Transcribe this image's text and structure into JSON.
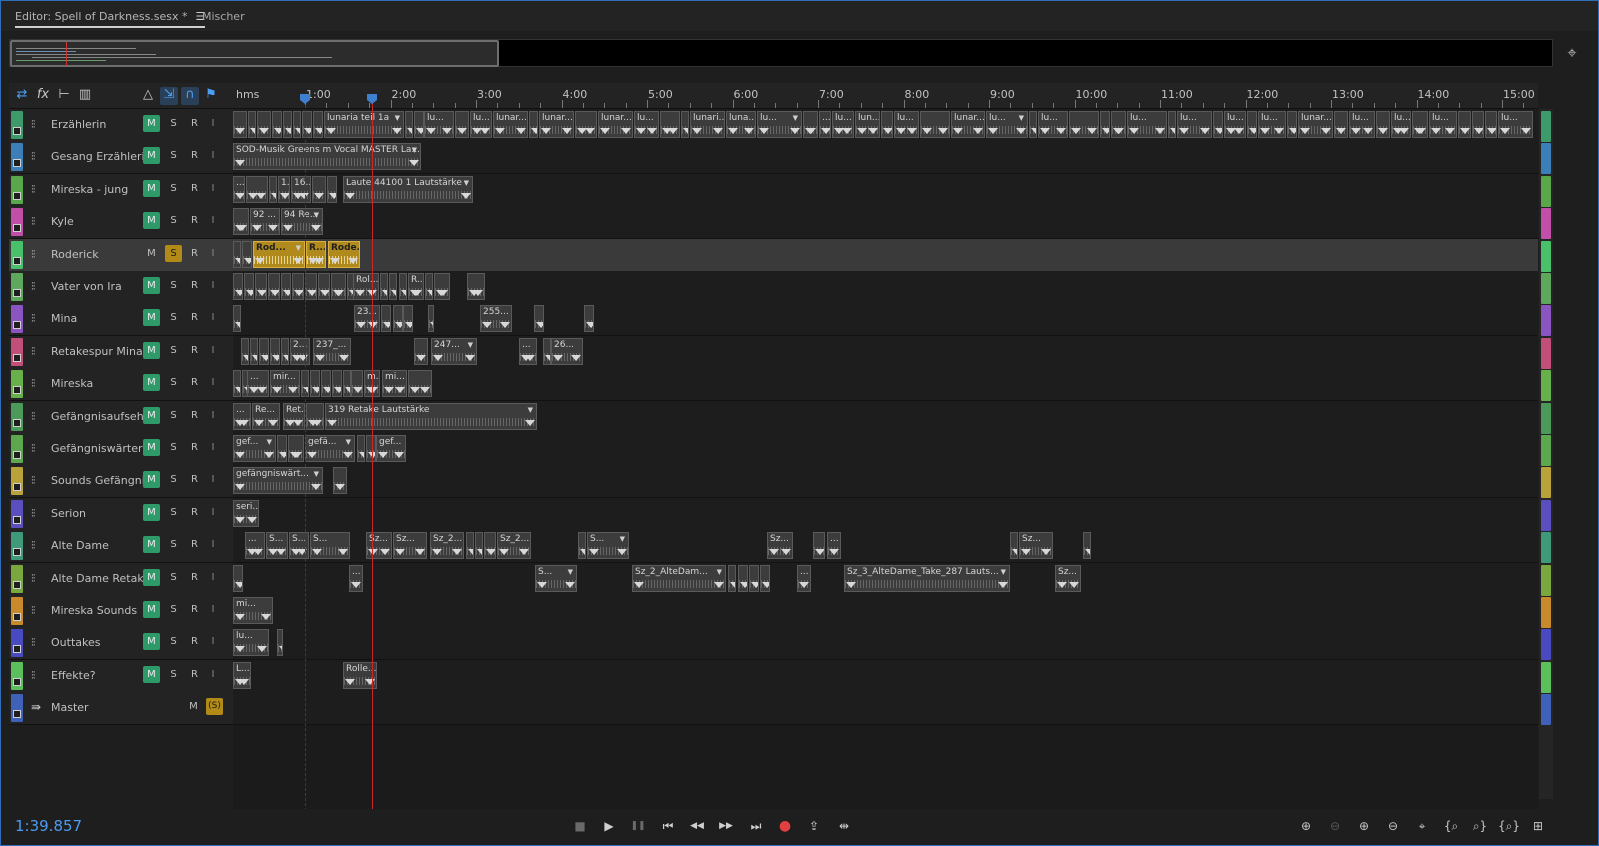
{
  "tabs": {
    "editor": "Editor: Spell of Darkness.sesx *",
    "mixer": "Mischer"
  },
  "ruler": {
    "format": "hms",
    "labels": [
      "1:00",
      "2:00",
      "3:00",
      "4:00",
      "5:00",
      "6:00",
      "7:00",
      "8:00",
      "9:00",
      "10:00",
      "11:00",
      "12:00",
      "13:00",
      "14:00",
      "15:00"
    ]
  },
  "tracks": [
    {
      "name": "Erzählerin",
      "color": "#3d9a6a",
      "mute": true,
      "solo": false,
      "clips": [
        {
          "s": 0,
          "w": 14
        },
        {
          "s": 15,
          "w": 8
        },
        {
          "s": 24,
          "w": 14
        },
        {
          "s": 39,
          "w": 10
        },
        {
          "s": 50,
          "w": 9
        },
        {
          "s": 60,
          "w": 8
        },
        {
          "s": 69,
          "w": 10
        },
        {
          "s": 80,
          "w": 10
        },
        {
          "s": 91,
          "w": 80,
          "label": "lunaria teil 1a"
        },
        {
          "s": 172,
          "w": 8
        },
        {
          "s": 181,
          "w": 10
        },
        {
          "s": 191,
          "w": 30,
          "label": "lu..."
        },
        {
          "s": 222,
          "w": 14
        },
        {
          "s": 237,
          "w": 22,
          "label": "lu..."
        },
        {
          "s": 260,
          "w": 35,
          "label": "lunar..."
        },
        {
          "s": 296,
          "w": 9
        },
        {
          "s": 306,
          "w": 35,
          "label": "lunar..."
        },
        {
          "s": 342,
          "w": 22
        },
        {
          "s": 365,
          "w": 35,
          "label": "lunar..."
        },
        {
          "s": 401,
          "w": 25,
          "label": "lu..."
        },
        {
          "s": 427,
          "w": 20
        },
        {
          "s": 448,
          "w": 8
        },
        {
          "s": 457,
          "w": 35,
          "label": "lunari..."
        },
        {
          "s": 493,
          "w": 30,
          "label": "luna..."
        },
        {
          "s": 524,
          "w": 45,
          "label": "lu..."
        },
        {
          "s": 570,
          "w": 15
        },
        {
          "s": 586,
          "w": 12,
          "label": "..."
        },
        {
          "s": 599,
          "w": 22,
          "label": "lu..."
        },
        {
          "s": 622,
          "w": 25,
          "label": "lun..."
        },
        {
          "s": 648,
          "w": 12
        },
        {
          "s": 661,
          "w": 25,
          "label": "lu..."
        },
        {
          "s": 687,
          "w": 30
        },
        {
          "s": 718,
          "w": 34,
          "label": "lunar..."
        },
        {
          "s": 753,
          "w": 42,
          "label": "lu..."
        },
        {
          "s": 796,
          "w": 8
        },
        {
          "s": 805,
          "w": 30,
          "label": "lu..."
        },
        {
          "s": 836,
          "w": 30
        },
        {
          "s": 867,
          "w": 10
        },
        {
          "s": 878,
          "w": 15
        },
        {
          "s": 894,
          "w": 40,
          "label": "lu..."
        },
        {
          "s": 935,
          "w": 8
        },
        {
          "s": 944,
          "w": 35,
          "label": "lu..."
        },
        {
          "s": 980,
          "w": 10
        },
        {
          "s": 991,
          "w": 22,
          "label": "lu..."
        },
        {
          "s": 1014,
          "w": 10
        },
        {
          "s": 1025,
          "w": 28,
          "label": "lu..."
        },
        {
          "s": 1054,
          "w": 10
        },
        {
          "s": 1065,
          "w": 35,
          "label": "lunar..."
        },
        {
          "s": 1101,
          "w": 14
        },
        {
          "s": 1116,
          "w": 26,
          "label": "lu..."
        },
        {
          "s": 1143,
          "w": 14
        },
        {
          "s": 1158,
          "w": 20,
          "label": "lu..."
        },
        {
          "s": 1179,
          "w": 16
        },
        {
          "s": 1196,
          "w": 28,
          "label": "lu..."
        },
        {
          "s": 1225,
          "w": 13
        },
        {
          "s": 1239,
          "w": 12
        },
        {
          "s": 1252,
          "w": 12
        },
        {
          "s": 1265,
          "w": 35,
          "label": "lu..."
        }
      ]
    },
    {
      "name": "Gesang Erzählerin",
      "color": "#3c7fb8",
      "mute": true,
      "solo": false,
      "clips": [
        {
          "s": 0,
          "w": 188,
          "label": "SOD-Musik Greens m Vocal MASTER La..."
        }
      ]
    },
    {
      "name": "Mireska - jung",
      "color": "#5aa64a",
      "mute": true,
      "solo": false,
      "clips": [
        {
          "s": 0,
          "w": 12,
          "label": "..."
        },
        {
          "s": 13,
          "w": 22
        },
        {
          "s": 36,
          "w": 8
        },
        {
          "s": 45,
          "w": 12,
          "label": "1..."
        },
        {
          "s": 58,
          "w": 20,
          "label": "16..."
        },
        {
          "s": 79,
          "w": 14
        },
        {
          "s": 94,
          "w": 10
        },
        {
          "s": 110,
          "w": 130,
          "label": "Laute 44100 1  Lautstärke"
        }
      ]
    },
    {
      "name": "Kyle",
      "color": "#c24fa7",
      "mute": true,
      "solo": false,
      "clips": [
        {
          "s": 0,
          "w": 16
        },
        {
          "s": 17,
          "w": 30,
          "label": "92 ..."
        },
        {
          "s": 48,
          "w": 42,
          "label": "94 Re..."
        }
      ]
    },
    {
      "name": "Roderick",
      "color": "#49c06a",
      "mute": false,
      "solo": true,
      "selected": true,
      "clips": [
        {
          "s": 0,
          "w": 8
        },
        {
          "s": 9,
          "w": 10
        },
        {
          "s": 20,
          "w": 52,
          "label": "Rod...",
          "gold": true
        },
        {
          "s": 73,
          "w": 20,
          "label": "R...",
          "gold": true
        },
        {
          "s": 95,
          "w": 32,
          "label": "Rode...",
          "gold": true
        }
      ]
    },
    {
      "name": "Vater von Ira",
      "color": "#5ea85e",
      "mute": true,
      "solo": false,
      "clips": [
        {
          "s": 0,
          "w": 10
        },
        {
          "s": 11,
          "w": 10
        },
        {
          "s": 22,
          "w": 12
        },
        {
          "s": 35,
          "w": 12
        },
        {
          "s": 48,
          "w": 10
        },
        {
          "s": 59,
          "w": 12
        },
        {
          "s": 72,
          "w": 12
        },
        {
          "s": 85,
          "w": 12
        },
        {
          "s": 98,
          "w": 15
        },
        {
          "s": 114,
          "w": 10
        },
        {
          "s": 120,
          "w": 26,
          "label": "Rol..."
        },
        {
          "s": 147,
          "w": 8
        },
        {
          "s": 156,
          "w": 8
        },
        {
          "s": 166,
          "w": 8
        },
        {
          "s": 175,
          "w": 16,
          "label": "R..."
        },
        {
          "s": 192,
          "w": 8
        },
        {
          "s": 201,
          "w": 16
        },
        {
          "s": 234,
          "w": 18
        }
      ]
    },
    {
      "name": "Mina",
      "color": "#8a55c0",
      "mute": true,
      "solo": false,
      "clips": [
        {
          "s": 0,
          "w": 8
        },
        {
          "s": 121,
          "w": 26,
          "label": "23..."
        },
        {
          "s": 148,
          "w": 10
        },
        {
          "s": 160,
          "w": 10
        },
        {
          "s": 170,
          "w": 10
        },
        {
          "s": 195,
          "w": 6
        },
        {
          "s": 247,
          "w": 32,
          "label": "255..."
        },
        {
          "s": 301,
          "w": 10
        },
        {
          "s": 351,
          "w": 10
        }
      ]
    },
    {
      "name": "Retakespur Mina",
      "color": "#c24f7a",
      "mute": true,
      "solo": false,
      "clips": [
        {
          "s": 8,
          "w": 8
        },
        {
          "s": 17,
          "w": 8
        },
        {
          "s": 26,
          "w": 10
        },
        {
          "s": 37,
          "w": 10
        },
        {
          "s": 48,
          "w": 8
        },
        {
          "s": 57,
          "w": 20,
          "label": "2..."
        },
        {
          "s": 80,
          "w": 38,
          "label": "237_..."
        },
        {
          "s": 181,
          "w": 14
        },
        {
          "s": 198,
          "w": 46,
          "label": "247..."
        },
        {
          "s": 286,
          "w": 18,
          "label": "..."
        },
        {
          "s": 310,
          "w": 8
        },
        {
          "s": 318,
          "w": 32,
          "label": "26..."
        }
      ]
    },
    {
      "name": "Mireska",
      "color": "#68b04a",
      "mute": true,
      "solo": false,
      "clips": [
        {
          "s": 0,
          "w": 8
        },
        {
          "s": 9,
          "w": 8
        },
        {
          "s": 14,
          "w": 22,
          "label": "..."
        },
        {
          "s": 37,
          "w": 30,
          "label": "mir..."
        },
        {
          "s": 68,
          "w": 8
        },
        {
          "s": 77,
          "w": 10
        },
        {
          "s": 88,
          "w": 10
        },
        {
          "s": 99,
          "w": 10
        },
        {
          "s": 110,
          "w": 8
        },
        {
          "s": 118,
          "w": 12
        },
        {
          "s": 131,
          "w": 16,
          "label": "m..."
        },
        {
          "s": 149,
          "w": 25,
          "label": "mi..."
        },
        {
          "s": 175,
          "w": 24
        }
      ]
    },
    {
      "name": "Gefängnisaufsehe",
      "color": "#4c9a5a",
      "mute": true,
      "solo": false,
      "clips": [
        {
          "s": 0,
          "w": 18,
          "label": "..."
        },
        {
          "s": 19,
          "w": 28,
          "label": "Re..."
        },
        {
          "s": 50,
          "w": 22,
          "label": "Ret..."
        },
        {
          "s": 73,
          "w": 18
        },
        {
          "s": 92,
          "w": 212,
          "label": "319 Retake  Lautstärke"
        }
      ]
    },
    {
      "name": "Gefängniswärter",
      "color": "#5da84f",
      "mute": true,
      "solo": false,
      "clips": [
        {
          "s": 0,
          "w": 43,
          "label": "gef..."
        },
        {
          "s": 44,
          "w": 10
        },
        {
          "s": 55,
          "w": 16
        },
        {
          "s": 72,
          "w": 50,
          "label": "gefä..."
        },
        {
          "s": 124,
          "w": 8
        },
        {
          "s": 133,
          "w": 10
        },
        {
          "s": 143,
          "w": 30,
          "label": "gef..."
        }
      ]
    },
    {
      "name": "Sounds Gefängnis",
      "color": "#b8a33a",
      "mute": true,
      "solo": false,
      "clips": [
        {
          "s": 0,
          "w": 90,
          "label": "gefängniswärt..."
        },
        {
          "s": 100,
          "w": 14
        }
      ]
    },
    {
      "name": "Serion",
      "color": "#5b4fc0",
      "mute": true,
      "solo": false,
      "clips": [
        {
          "s": 0,
          "w": 26,
          "label": "seri..."
        }
      ]
    },
    {
      "name": "Alte Dame",
      "color": "#3f9a7a",
      "mute": true,
      "solo": false,
      "clips": [
        {
          "s": 12,
          "w": 20,
          "label": "..."
        },
        {
          "s": 33,
          "w": 22,
          "label": "S..."
        },
        {
          "s": 56,
          "w": 20,
          "label": "S..."
        },
        {
          "s": 77,
          "w": 40,
          "label": "S..."
        },
        {
          "s": 133,
          "w": 26,
          "label": "Sz..."
        },
        {
          "s": 160,
          "w": 34,
          "label": "Sz..."
        },
        {
          "s": 197,
          "w": 34,
          "label": "Sz_2..."
        },
        {
          "s": 233,
          "w": 8
        },
        {
          "s": 242,
          "w": 8
        },
        {
          "s": 251,
          "w": 12
        },
        {
          "s": 264,
          "w": 34,
          "label": "Sz_2..."
        },
        {
          "s": 345,
          "w": 8
        },
        {
          "s": 354,
          "w": 42,
          "label": "S..."
        },
        {
          "s": 534,
          "w": 26,
          "label": "Sz..."
        },
        {
          "s": 580,
          "w": 12
        },
        {
          "s": 594,
          "w": 14,
          "label": "..."
        },
        {
          "s": 777,
          "w": 8
        },
        {
          "s": 786,
          "w": 34,
          "label": "Sz..."
        },
        {
          "s": 850,
          "w": 8
        }
      ]
    },
    {
      "name": "Alte Dame Retake",
      "color": "#7aa83f",
      "mute": true,
      "solo": false,
      "clips": [
        {
          "s": 0,
          "w": 10
        },
        {
          "s": 116,
          "w": 14,
          "label": "..."
        },
        {
          "s": 302,
          "w": 42,
          "label": "S..."
        },
        {
          "s": 399,
          "w": 94,
          "label": "Sz_2_AlteDam..."
        },
        {
          "s": 495,
          "w": 8
        },
        {
          "s": 505,
          "w": 10
        },
        {
          "s": 516,
          "w": 10
        },
        {
          "s": 527,
          "w": 10
        },
        {
          "s": 564,
          "w": 14,
          "label": "..."
        },
        {
          "s": 611,
          "w": 166,
          "label": "Sz_3_AlteDame_Take_287 Lauts..."
        },
        {
          "s": 822,
          "w": 26,
          "label": "Sz..."
        }
      ]
    },
    {
      "name": "Mireska Sounds",
      "color": "#c88a2a",
      "mute": true,
      "solo": false,
      "clips": [
        {
          "s": 0,
          "w": 40,
          "label": "mi..."
        }
      ]
    },
    {
      "name": "Outtakes",
      "color": "#4a4ac0",
      "mute": true,
      "solo": false,
      "clips": [
        {
          "s": 0,
          "w": 36,
          "label": "lu..."
        },
        {
          "s": 44,
          "w": 6
        }
      ]
    },
    {
      "name": "Effekte?",
      "color": "#5bc05b",
      "mute": true,
      "solo": false,
      "clips": [
        {
          "s": 0,
          "w": 18,
          "label": "L..."
        },
        {
          "s": 110,
          "w": 34,
          "label": "Rolle..."
        }
      ]
    }
  ],
  "track_buttons": {
    "m": "M",
    "s": "S",
    "r": "R",
    "i": "I"
  },
  "master": {
    "name": "Master",
    "m": "M",
    "s": "(S)"
  },
  "time_display": "1:39.857",
  "rail_colors": [
    "#3d9a6a",
    "#3c7fb8",
    "#5aa64a",
    "#c24fa7",
    "#49c06a",
    "#5ea85e",
    "#8a55c0",
    "#c24f7a",
    "#68b04a",
    "#4c9a5a",
    "#5da84f",
    "#b8a33a",
    "#5b4fc0",
    "#3f9a7a",
    "#7aa83f",
    "#c88a2a",
    "#4a4ac0",
    "#5bc05b",
    "#3f62b8"
  ],
  "transport": {
    "stop": "■",
    "play": "▶",
    "pause": "❚❚",
    "to_start": "⏮",
    "rewind": "◀◀",
    "forward": "▶▶",
    "to_end": "⏭",
    "record": "●",
    "loop": "⇪",
    "skip": "⇹"
  }
}
